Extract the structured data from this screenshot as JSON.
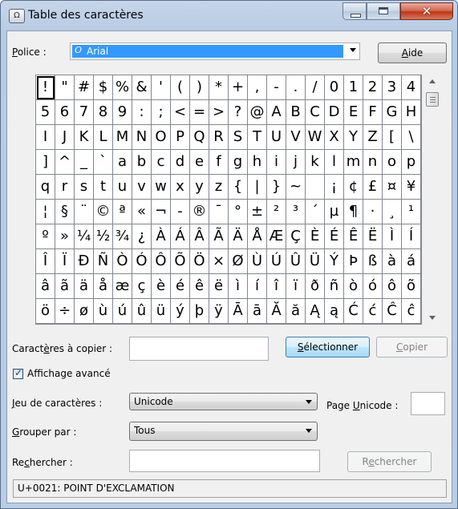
{
  "window": {
    "title": "Table des caractères",
    "close_glyph": "✕"
  },
  "font": {
    "label_pre": "",
    "label_u": "P",
    "label_post": "olice :",
    "value": "Arial",
    "icon_glyph": "O"
  },
  "help_button": {
    "u": "A",
    "rest": "ide"
  },
  "grid": {
    "columns": 20,
    "selected_index": 0,
    "chars": [
      "!",
      "\"",
      "#",
      "$",
      "%",
      "&",
      "'",
      "(",
      ")",
      "*",
      "+",
      ",",
      "-",
      ".",
      "/",
      "0",
      "1",
      "2",
      "3",
      "4",
      "5",
      "6",
      "7",
      "8",
      "9",
      ":",
      ";",
      "<",
      "=",
      ">",
      "?",
      "@",
      "A",
      "B",
      "C",
      "D",
      "E",
      "F",
      "G",
      "H",
      "I",
      "J",
      "K",
      "L",
      "M",
      "N",
      "O",
      "P",
      "Q",
      "R",
      "S",
      "T",
      "U",
      "V",
      "W",
      "X",
      "Y",
      "Z",
      "[",
      "\\",
      "]",
      "^",
      "_",
      "`",
      "a",
      "b",
      "c",
      "d",
      "e",
      "f",
      "g",
      "h",
      "i",
      "j",
      "k",
      "l",
      "m",
      "n",
      "o",
      "p",
      "q",
      "r",
      "s",
      "t",
      "u",
      "v",
      "w",
      "x",
      "y",
      "z",
      "{",
      "|",
      "}",
      "~",
      " ",
      "¡",
      "¢",
      "£",
      "¤",
      "¥",
      "¦",
      "§",
      "¨",
      "©",
      "ª",
      "«",
      "¬",
      "-",
      "®",
      "¯",
      "°",
      "±",
      "²",
      "³",
      "´",
      "µ",
      "¶",
      "·",
      "¸",
      "¹",
      "º",
      "»",
      "¼",
      "½",
      "¾",
      "¿",
      "À",
      "Á",
      "Â",
      "Ã",
      "Ä",
      "Å",
      "Æ",
      "Ç",
      "È",
      "É",
      "Ê",
      "Ë",
      "Ì",
      "Í",
      "Î",
      "Ï",
      "Ð",
      "Ñ",
      "Ò",
      "Ó",
      "Ô",
      "Õ",
      "Ö",
      "×",
      "Ø",
      "Ù",
      "Ú",
      "Û",
      "Ü",
      "Ý",
      "Þ",
      "ß",
      "à",
      "á",
      "â",
      "ã",
      "ä",
      "å",
      "æ",
      "ç",
      "è",
      "é",
      "ê",
      "ë",
      "ì",
      "í",
      "î",
      "ï",
      "ð",
      "ñ",
      "ò",
      "ó",
      "ô",
      "õ",
      "ö",
      "÷",
      "ø",
      "ù",
      "ú",
      "û",
      "ü",
      "ý",
      "þ",
      "ÿ",
      "Ā",
      "ā",
      "Ă",
      "ă",
      "Ą",
      "ą",
      "Ć",
      "ć",
      "Ĉ",
      "ĉ"
    ]
  },
  "copy": {
    "label_pre": "Caract",
    "label_u": "è",
    "label_post": "res à copier :",
    "value": "",
    "select_u": "S",
    "select_rest": "électionner",
    "copy_pre": "",
    "copy_u": "C",
    "copy_post": "opier"
  },
  "advanced": {
    "checked_glyph": "✓",
    "label": "Affichage avancé"
  },
  "charset": {
    "label_u": "J",
    "label_rest": "eu de caractères :",
    "value": "Unicode",
    "page_label_pre": "Page ",
    "page_label_u": "U",
    "page_label_post": "nicode :",
    "page_value": ""
  },
  "group": {
    "label_u": "G",
    "label_rest": "rouper par :",
    "value": "Tous"
  },
  "search": {
    "label_pre": "Re",
    "label_u": "c",
    "label_post": "hercher :",
    "value": "",
    "button_pre": "R",
    "button_u": "e",
    "button_post": "chercher"
  },
  "status_text": "U+0021: POINT D'EXCLAMATION"
}
